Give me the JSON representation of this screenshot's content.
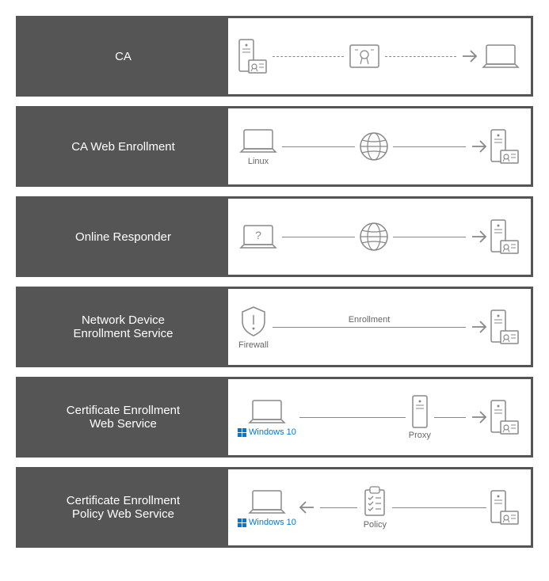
{
  "rows": [
    {
      "label": "CA"
    },
    {
      "label": "CA Web Enrollment",
      "caption1": "Linux"
    },
    {
      "label": "Online Responder"
    },
    {
      "label": "Network Device\nEnrollment Service",
      "caption1": "Firewall",
      "conn_label": "Enrollment"
    },
    {
      "label": "Certificate Enrollment\nWeb Service",
      "caption1": "Windows 10",
      "caption2": "Proxy"
    },
    {
      "label": "Certificate Enrollment\nPolicy Web Service",
      "caption1": "Windows 10",
      "caption2": "Policy"
    }
  ]
}
